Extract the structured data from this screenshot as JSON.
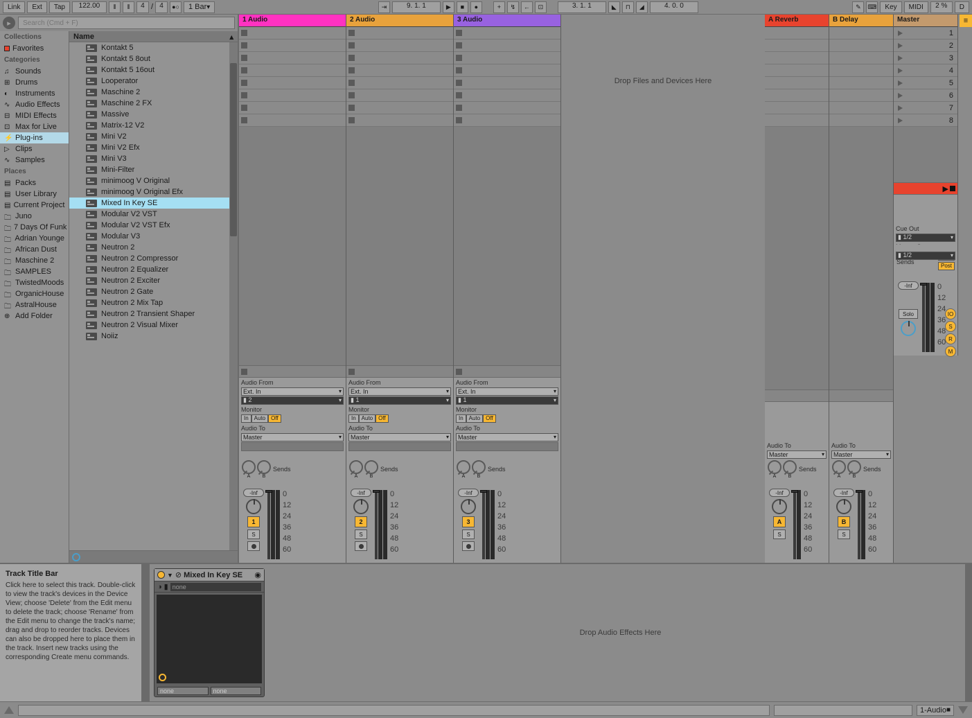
{
  "topbar": {
    "link": "Link",
    "ext": "Ext",
    "tap": "Tap",
    "tempo": "122.00",
    "sig_num": "4",
    "sig_den": "4",
    "metronome": "1 Bar",
    "bar_position": "9. 1. 1",
    "loop_start": "3. 1. 1",
    "loop_length": "4. 0. 0",
    "key": "Key",
    "midi": "MIDI",
    "cpu": "2 %",
    "disk": "D"
  },
  "search": {
    "placeholder": "Search (Cmd + F)"
  },
  "browser_left": {
    "collections_hdr": "Collections",
    "favorites": "Favorites",
    "categories_hdr": "Categories",
    "categories": [
      "Sounds",
      "Drums",
      "Instruments",
      "Audio Effects",
      "MIDI Effects",
      "Max for Live",
      "Plug-ins",
      "Clips",
      "Samples"
    ],
    "places_hdr": "Places",
    "places": [
      "Packs",
      "User Library",
      "Current Project",
      "Juno",
      "7 Days Of Funk",
      "Adrian Younge",
      "African Dust",
      "Maschine 2",
      "SAMPLES",
      "TwistedMoods",
      "OrganicHouse",
      "AstralHouse",
      "Add Folder"
    ]
  },
  "browser_right": {
    "header": "Name",
    "items": [
      "Kontakt 5",
      "Kontakt 5 8out",
      "Kontakt 5 16out",
      "Looperator",
      "Maschine 2",
      "Maschine 2 FX",
      "Massive",
      "Matrix-12 V2",
      "Mini V2",
      "Mini V2 Efx",
      "Mini V3",
      "Mini-Filter",
      "minimoog V Original",
      "minimoog V Original Efx",
      "Mixed In Key SE",
      "Modular V2 VST",
      "Modular V2 VST Efx",
      "Modular V3",
      "Neutron 2",
      "Neutron 2 Compressor",
      "Neutron 2 Equalizer",
      "Neutron 2 Exciter",
      "Neutron 2 Gate",
      "Neutron 2 Mix Tap",
      "Neutron 2 Transient Shaper",
      "Neutron 2 Visual Mixer",
      "Noiiz"
    ],
    "selected_index": 14
  },
  "tracks": [
    {
      "name": "1 Audio",
      "color": "t1",
      "audio_from": "Ext. In",
      "channel": "2",
      "monitor": "Off",
      "audio_to": "Master",
      "vol": "-Inf",
      "activator": "1"
    },
    {
      "name": "2 Audio",
      "color": "t2",
      "audio_from": "Ext. In",
      "channel": "1",
      "monitor": "Off",
      "audio_to": "Master",
      "vol": "-Inf",
      "activator": "2"
    },
    {
      "name": "3 Audio",
      "color": "t3",
      "audio_from": "Ext. In",
      "channel": "1",
      "monitor": "Off",
      "audio_to": "Master",
      "vol": "-Inf",
      "activator": "3"
    }
  ],
  "drop_files": "Drop Files and Devices Here",
  "returns": [
    {
      "name": "A Reverb",
      "color": "tA",
      "audio_to": "Master",
      "vol": "-Inf",
      "activator": "A"
    },
    {
      "name": "B Delay",
      "color": "tB",
      "audio_to": "Master",
      "vol": "-Inf",
      "activator": "B"
    }
  ],
  "master": {
    "name": "Master",
    "color": "tM",
    "scenes": [
      "1",
      "2",
      "3",
      "4",
      "5",
      "6",
      "7",
      "8"
    ],
    "cue_out_label": "Cue Out",
    "cue_out": "1/2",
    "master_out_label": "Master Out",
    "master_out": "1/2",
    "vol": "-Inf",
    "solo": "Solo",
    "post": "Post"
  },
  "io_labels": {
    "audio_from": "Audio From",
    "monitor": "Monitor",
    "audio_to": "Audio To",
    "sends": "Sends",
    "in": "In",
    "auto": "Auto",
    "off": "Off",
    "s": "S"
  },
  "db_scale": [
    "0",
    "12",
    "24",
    "36",
    "48",
    "60"
  ],
  "info": {
    "title": "Track Title Bar",
    "body": "Click here to select this track. Double-click to view the track's devices in the Device View; choose 'Delete' from the Edit menu to delete the track; choose 'Rename' from the Edit menu to change the track's name; drag and drop to reorder tracks. Devices can also be dropped here to place them in the track. Insert new tracks using the corresponding Create menu commands."
  },
  "device": {
    "name": "Mixed In Key SE",
    "preset": "none",
    "foot1": "none",
    "foot2": "none"
  },
  "drop_fx": "Drop Audio Effects Here",
  "status": {
    "track": "1-Audio"
  }
}
